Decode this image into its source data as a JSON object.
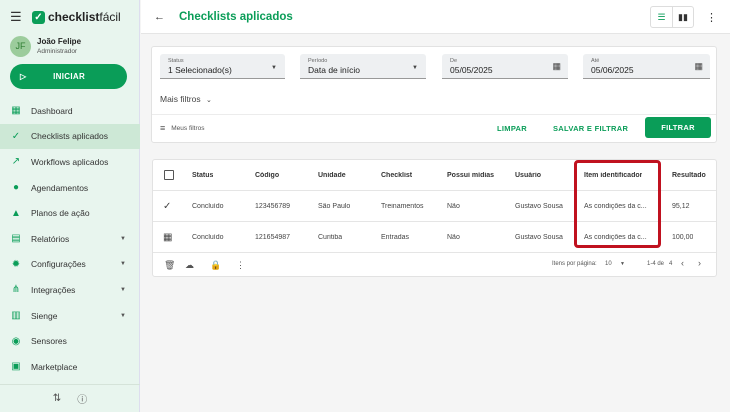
{
  "brand": {
    "name_bold": "checklist",
    "name_regular": "fácil"
  },
  "user": {
    "initials": "JF",
    "name": "João Felipe",
    "role": "Administrador"
  },
  "start_button": "INICIAR",
  "nav": [
    {
      "label": "Dashboard",
      "icon": "dashboard-icon",
      "glyph": "▦",
      "active": false,
      "caret": false
    },
    {
      "label": "Checklists aplicados",
      "icon": "check-icon",
      "glyph": "✓",
      "active": true,
      "caret": false
    },
    {
      "label": "Workflows aplicados",
      "icon": "trending-icon",
      "glyph": "↗",
      "active": false,
      "caret": false
    },
    {
      "label": "Agendamentos",
      "icon": "clock-icon",
      "glyph": "●",
      "active": false,
      "caret": false
    },
    {
      "label": "Planos de ação",
      "icon": "warning-icon",
      "glyph": "▲",
      "active": false,
      "caret": false
    },
    {
      "label": "Relatórios",
      "icon": "clipboard-icon",
      "glyph": "▤",
      "active": false,
      "caret": true
    },
    {
      "label": "Configurações",
      "icon": "gear-icon",
      "glyph": "✹",
      "active": false,
      "caret": true
    },
    {
      "label": "Integrações",
      "icon": "hub-icon",
      "glyph": "⋔",
      "active": false,
      "caret": true
    },
    {
      "label": "Sienge",
      "icon": "building-icon",
      "glyph": "▥",
      "active": false,
      "caret": true
    },
    {
      "label": "Sensores",
      "icon": "sensor-icon",
      "glyph": "◉",
      "active": false,
      "caret": false
    },
    {
      "label": "Marketplace",
      "icon": "bag-icon",
      "glyph": "▣",
      "active": false,
      "caret": false
    }
  ],
  "header": {
    "title": "Checklists aplicados"
  },
  "filters": {
    "status": {
      "label": "Status",
      "value": "1 Selecionado(s)"
    },
    "period": {
      "label": "Período",
      "value": "Data de início"
    },
    "from": {
      "label": "De",
      "value": "05/05/2025"
    },
    "to": {
      "label": "Até",
      "value": "05/06/2025"
    },
    "more": "Mais filtros",
    "my_filters": "Meus filtros",
    "clear": "LIMPAR",
    "save_filter": "SALVAR E FILTRAR",
    "filter": "FILTRAR"
  },
  "table": {
    "columns": [
      "Status",
      "Código",
      "Unidade",
      "Checklist",
      "Possui mídias",
      "Usuário",
      "Item identificador",
      "Resultado"
    ],
    "rows": [
      {
        "icon": "check-icon",
        "status": "Concluído",
        "code": "123456789",
        "unit": "São Paulo",
        "checklist": "Treinamentos",
        "media": "Não",
        "user": "Gustavo Sousa",
        "item": "As condições da c...",
        "result": "95,12"
      },
      {
        "icon": "calendar-icon",
        "status": "Concluído",
        "code": "121654987",
        "unit": "Curitiba",
        "checklist": "Entradas",
        "media": "Não",
        "user": "Gustavo Sousa",
        "item": "As condições da c...",
        "result": "100,00"
      }
    ],
    "pagination": {
      "per_page_label": "Itens por página:",
      "per_page": "10",
      "range": "1-4 de",
      "total": "4"
    }
  }
}
